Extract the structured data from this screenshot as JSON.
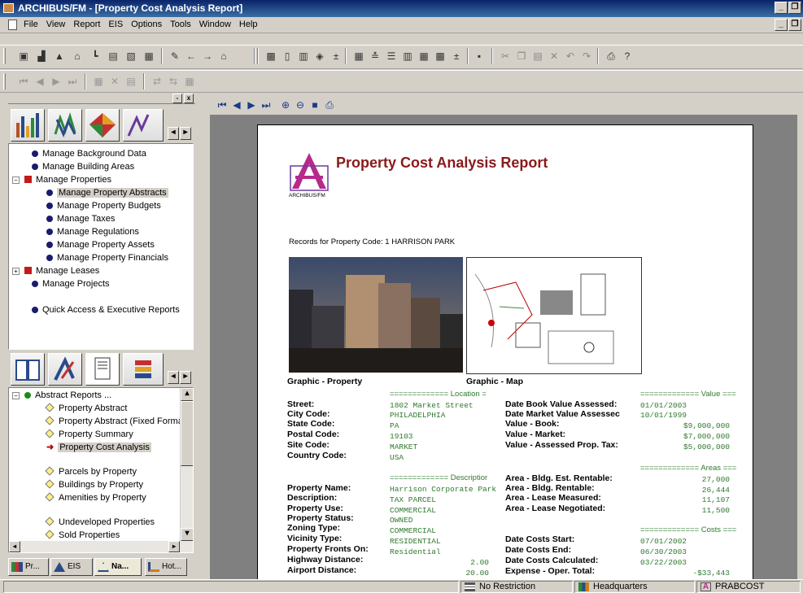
{
  "window": {
    "title": "ARCHIBUS/FM - [Property Cost Analysis Report]",
    "min": "_",
    "restore": "❐",
    "close": "x"
  },
  "menu": [
    "File",
    "View",
    "Report",
    "EIS",
    "Options",
    "Tools",
    "Window",
    "Help"
  ],
  "nav_pane": {
    "items": [
      {
        "label": "Manage Background Data",
        "level": 0,
        "marker": "dot"
      },
      {
        "label": "Manage Building Areas",
        "level": 0,
        "marker": "dot"
      },
      {
        "label": "Manage Properties",
        "level": 0,
        "marker": "square",
        "expander": "−"
      },
      {
        "label": "Manage Property Abstracts",
        "level": 1,
        "marker": "dot",
        "selected": true
      },
      {
        "label": "Manage Property Budgets",
        "level": 1,
        "marker": "dot"
      },
      {
        "label": "Manage Taxes",
        "level": 1,
        "marker": "dot"
      },
      {
        "label": "Manage Regulations",
        "level": 1,
        "marker": "dot"
      },
      {
        "label": "Manage Property Assets",
        "level": 1,
        "marker": "dot"
      },
      {
        "label": "Manage Property Financials",
        "level": 1,
        "marker": "dot"
      },
      {
        "label": "Manage Leases",
        "level": 0,
        "marker": "square",
        "expander": "+"
      },
      {
        "label": "Manage Projects",
        "level": 0,
        "marker": "dot"
      },
      {
        "label": "Quick Access & Executive Reports",
        "level": 0,
        "marker": "dot"
      }
    ]
  },
  "reports_pane": {
    "items": [
      {
        "label": "Abstract Reports ...",
        "marker": "gdot",
        "expander": "−"
      },
      {
        "label": "Property Abstract",
        "marker": "diamond"
      },
      {
        "label": "Property Abstract (Fixed Format)",
        "marker": "diamond"
      },
      {
        "label": "Property Summary",
        "marker": "diamond"
      },
      {
        "label": "Property Cost Analysis",
        "marker": "arrow",
        "selected": true
      },
      {
        "label": "Parcels by Property",
        "marker": "diamond"
      },
      {
        "label": "Buildings by Property",
        "marker": "diamond"
      },
      {
        "label": "Amenities by Property",
        "marker": "diamond"
      },
      {
        "label": "Undeveloped Properties",
        "marker": "diamond"
      },
      {
        "label": "Sold Properties",
        "marker": "diamond"
      }
    ]
  },
  "bottom_tabs": [
    "Pr...",
    "EIS",
    "Na...",
    "Hot..."
  ],
  "report": {
    "title": "Property Cost Analysis Report",
    "logo_text": "ARCHIBUS/FM",
    "records_line": "Records for Property Code: 1 HARRISON PARK",
    "graphic_property_label": "Graphic - Property",
    "graphic_map_label": "Graphic - Map",
    "location_header": "============= Location =",
    "value_header": "============= Value ===",
    "description_header": "============= Descriptior",
    "areas_header": "============= Areas ===",
    "costs_header": "============= Costs ===",
    "left_fields": [
      {
        "label": "Street:",
        "value": "1802 Market Street"
      },
      {
        "label": "City Code:",
        "value": "PHILADELPHIA"
      },
      {
        "label": "State Code:",
        "value": "PA"
      },
      {
        "label": "Postal Code:",
        "value": "19103"
      },
      {
        "label": "Site Code:",
        "value": "MARKET"
      },
      {
        "label": "Country Code:",
        "value": "USA"
      }
    ],
    "desc_fields": [
      {
        "label": "Property Name:",
        "value": "Harrison Corporate Park"
      },
      {
        "label": "Description:",
        "value": "TAX PARCEL"
      },
      {
        "label": "Property Use:",
        "value": "COMMERCIAL"
      },
      {
        "label": "Property Status:",
        "value": "OWNED"
      },
      {
        "label": "Zoning Type:",
        "value": "COMMERCIAL"
      },
      {
        "label": "Vicinity Type:",
        "value": "RESIDENTIAL"
      },
      {
        "label": "Property Fronts On:",
        "value": "Residential"
      },
      {
        "label": "Highway Distance:",
        "value": "2.00"
      },
      {
        "label": "Airport Distance:",
        "value": "20.00"
      }
    ],
    "value_fields": [
      {
        "label": "Date Book Value Assessed:",
        "value": "01/01/2003"
      },
      {
        "label": "Date Market Value Assessec",
        "value": "10/01/1999"
      },
      {
        "label": "Value - Book:",
        "value": "$9,000,000"
      },
      {
        "label": "Value - Market:",
        "value": "$7,000,000"
      },
      {
        "label": "Value -  Assessed Prop. Tax:",
        "value": "$5,000,000"
      }
    ],
    "area_fields": [
      {
        "label": "Area - Bldg. Est. Rentable:",
        "value": "27,000"
      },
      {
        "label": "Area - Bldg. Rentable:",
        "value": "26,444"
      },
      {
        "label": "Area - Lease Measured:",
        "value": "11,107"
      },
      {
        "label": "Area - Lease Negotiated:",
        "value": "11,500"
      }
    ],
    "cost_fields": [
      {
        "label": "Date Costs Start:",
        "value": "07/01/2002"
      },
      {
        "label": "Date Costs End:",
        "value": "06/30/2003"
      },
      {
        "label": "Date Costs Calculated:",
        "value": "03/22/2003"
      },
      {
        "label": "Expense - Oper. Total:",
        "value": "-$33,443"
      }
    ]
  },
  "status": {
    "restriction": "No Restriction",
    "project": "Headquarters",
    "view": "PRABCOST"
  }
}
